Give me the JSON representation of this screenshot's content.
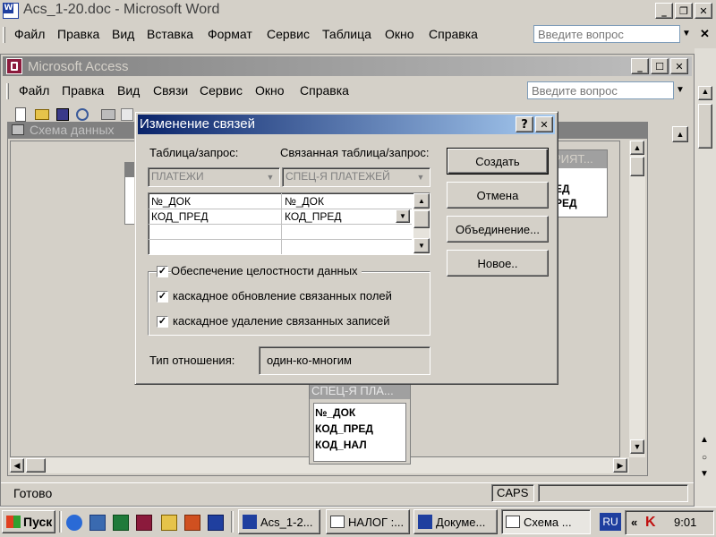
{
  "word": {
    "title": "Acs_1-20.doc - Microsoft Word",
    "menu": [
      "Файл",
      "Правка",
      "Вид",
      "Вставка",
      "Формат",
      "Сервис",
      "Таблица",
      "Окно",
      "Справка"
    ],
    "ask_placeholder": "Введите вопрос"
  },
  "access": {
    "title": "Microsoft Access",
    "menu": [
      "Файл",
      "Правка",
      "Вид",
      "Связи",
      "Сервис",
      "Окно",
      "Справка"
    ],
    "ask_placeholder": "Введите вопрос",
    "status_left": "Готово",
    "status_caps": "CAPS"
  },
  "schema": {
    "title": "Схема данных",
    "table_right": {
      "title": "РИЯТ...",
      "fields": [
        "ЕД",
        "РЕД"
      ]
    },
    "table_bottom": {
      "title": "СПЕЦ-Я ПЛА...",
      "fields": [
        "№_ДОК",
        "КОД_ПРЕД",
        "КОД_НАЛ"
      ]
    }
  },
  "dialog": {
    "title": "Изменение связей",
    "label_table": "Таблица/запрос:",
    "label_related": "Связанная таблица/запрос:",
    "table_value": "ПЛАТЕЖИ",
    "related_value": "СПЕЦ-Я ПЛАТЕЖЕЙ",
    "grid_rows": [
      [
        "№_ДОК",
        "№_ДОК"
      ],
      [
        "КОД_ПРЕД",
        "КОД_ПРЕД"
      ],
      [
        "",
        ""
      ],
      [
        "",
        ""
      ]
    ],
    "check_integrity": "Обеспечение целостности данных",
    "check_cascade_update": "каскадное обновление связанных полей",
    "check_cascade_delete": "каскадное удаление связанных записей",
    "checks": [
      true,
      true,
      true
    ],
    "rel_type_label": "Тип отношения:",
    "rel_type_value": "один-ко-многим",
    "buttons": {
      "create": "Создать",
      "cancel": "Отмена",
      "join": "Объединение...",
      "new": "Новое.."
    }
  },
  "taskbar": {
    "start": "Пуск",
    "tasks": [
      "Acs_1-2...",
      "НАЛОГ :...",
      "Докуме...",
      "Схема ..."
    ],
    "lang": "RU",
    "time": "9:01"
  },
  "colors": {
    "title_active_start": "#0a246a",
    "title_active_end": "#a6caf0",
    "title_inactive": "#808080",
    "face": "#d4d0c8"
  }
}
